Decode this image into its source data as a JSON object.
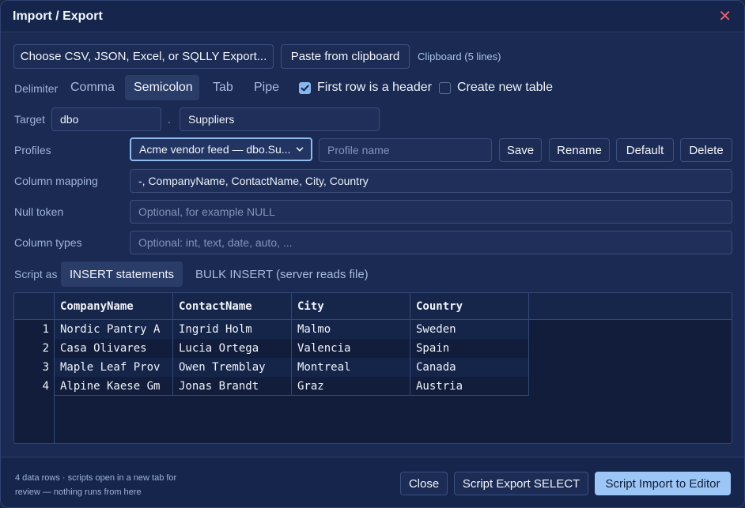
{
  "window": {
    "title": "Import / Export"
  },
  "source": {
    "choose_label": "Choose CSV, JSON, Excel, or SQLLY Export...",
    "paste_label": "Paste from clipboard",
    "clipboard_status": "Clipboard (5 lines)"
  },
  "delimiter": {
    "label": "Delimiter",
    "options": [
      "Comma",
      "Semicolon",
      "Tab",
      "Pipe"
    ],
    "selected": "Semicolon",
    "first_row_header_label": "First row is a header",
    "first_row_header_checked": true,
    "create_table_label": "Create new table",
    "create_table_checked": false
  },
  "target": {
    "label": "Target",
    "schema": "dbo",
    "separator": ".",
    "table": "Suppliers"
  },
  "profiles": {
    "label": "Profiles",
    "selected": "Acme vendor feed — dbo.Su...",
    "name_placeholder": "Profile name",
    "save_label": "Save",
    "rename_label": "Rename",
    "default_label": "Default",
    "delete_label": "Delete"
  },
  "column_mapping": {
    "label": "Column mapping",
    "value": "-, CompanyName, ContactName, City, Country"
  },
  "null_token": {
    "label": "Null token",
    "placeholder": "Optional, for example NULL"
  },
  "column_types": {
    "label": "Column types",
    "placeholder": "Optional: int, text, date, auto, ..."
  },
  "script_as": {
    "label": "Script as",
    "options": [
      "INSERT statements",
      "BULK INSERT (server reads file)"
    ],
    "selected": "INSERT statements"
  },
  "preview": {
    "columns": [
      "CompanyName",
      "ContactName",
      "City",
      "Country"
    ],
    "rows": [
      {
        "n": "1",
        "cells": [
          "Nordic Pantry A",
          "Ingrid Holm",
          "Malmo",
          "Sweden"
        ]
      },
      {
        "n": "2",
        "cells": [
          "Casa Olivares",
          "Lucia Ortega",
          "Valencia",
          "Spain"
        ]
      },
      {
        "n": "3",
        "cells": [
          "Maple Leaf Prov",
          "Owen Tremblay",
          "Montreal",
          "Canada"
        ]
      },
      {
        "n": "4",
        "cells": [
          "Alpine Kaese Gm",
          "Jonas Brandt",
          "Graz",
          "Austria"
        ]
      }
    ]
  },
  "footer": {
    "note_line1": "4 data rows · scripts open in a new tab for",
    "note_line2": "review — nothing runs from here",
    "close_label": "Close",
    "export_label": "Script Export SELECT",
    "import_label": "Script Import to Editor"
  },
  "colors": {
    "accent": "#9cc6f5",
    "close_icon": "#ef5d6b",
    "background": "#1a2a52"
  }
}
